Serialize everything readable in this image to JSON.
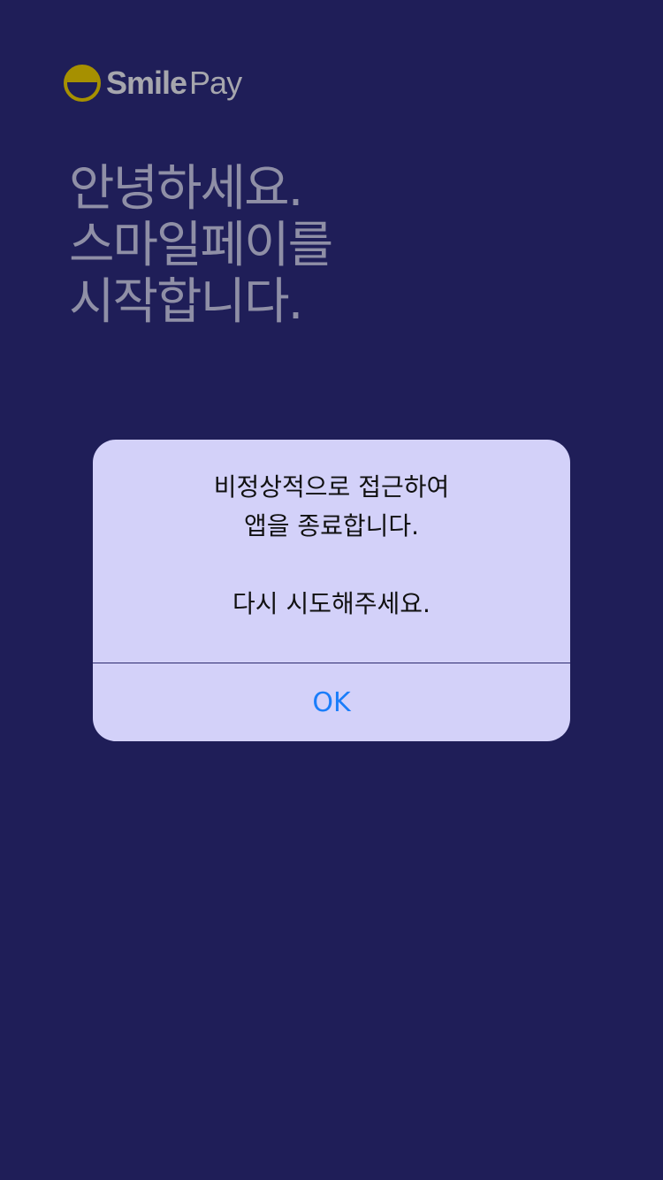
{
  "brand": {
    "logo_icon": "smile-face-icon",
    "name_bold": "Smile",
    "name_light": "Pay",
    "logo_color": "#a69000"
  },
  "greeting": {
    "line1": "안녕하세요.",
    "line2": "스마일페이를",
    "line3": "시작합니다."
  },
  "alert": {
    "message_line1": "비정상적으로 접근하여",
    "message_line2": "앱을 종료합니다.",
    "message_line3": "다시 시도해주세요.",
    "ok_label": "OK",
    "accent_color": "#1a7dfa"
  },
  "colors": {
    "background": "#1f1e58",
    "dialog": "#d3d1f9"
  }
}
